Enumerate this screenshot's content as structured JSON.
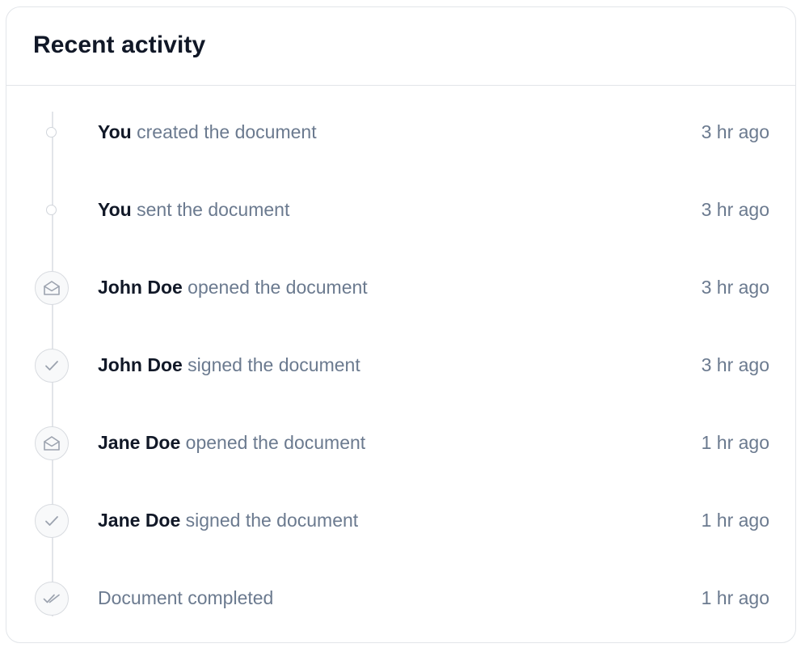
{
  "card": {
    "title": "Recent activity"
  },
  "activity": [
    {
      "actor": "You",
      "action": "created the document",
      "time": "3 hr ago",
      "icon": "dot-icon"
    },
    {
      "actor": "You",
      "action": "sent the document",
      "time": "3 hr ago",
      "icon": "dot-icon"
    },
    {
      "actor": "John Doe",
      "action": "opened the document",
      "time": "3 hr ago",
      "icon": "envelope-open-icon"
    },
    {
      "actor": "John Doe",
      "action": "signed the document",
      "time": "3 hr ago",
      "icon": "check-icon"
    },
    {
      "actor": "Jane Doe",
      "action": "opened the document",
      "time": "1 hr ago",
      "icon": "envelope-open-icon"
    },
    {
      "actor": "Jane Doe",
      "action": "signed the document",
      "time": "1 hr ago",
      "icon": "check-icon"
    },
    {
      "actor": "",
      "action": "Document completed",
      "time": "1 hr ago",
      "icon": "double-check-icon"
    }
  ],
  "colors": {
    "title": "#111827",
    "actor": "#111827",
    "muted": "#6b7a8f",
    "border": "#e2e5e9",
    "icon": "#9ca3af"
  }
}
